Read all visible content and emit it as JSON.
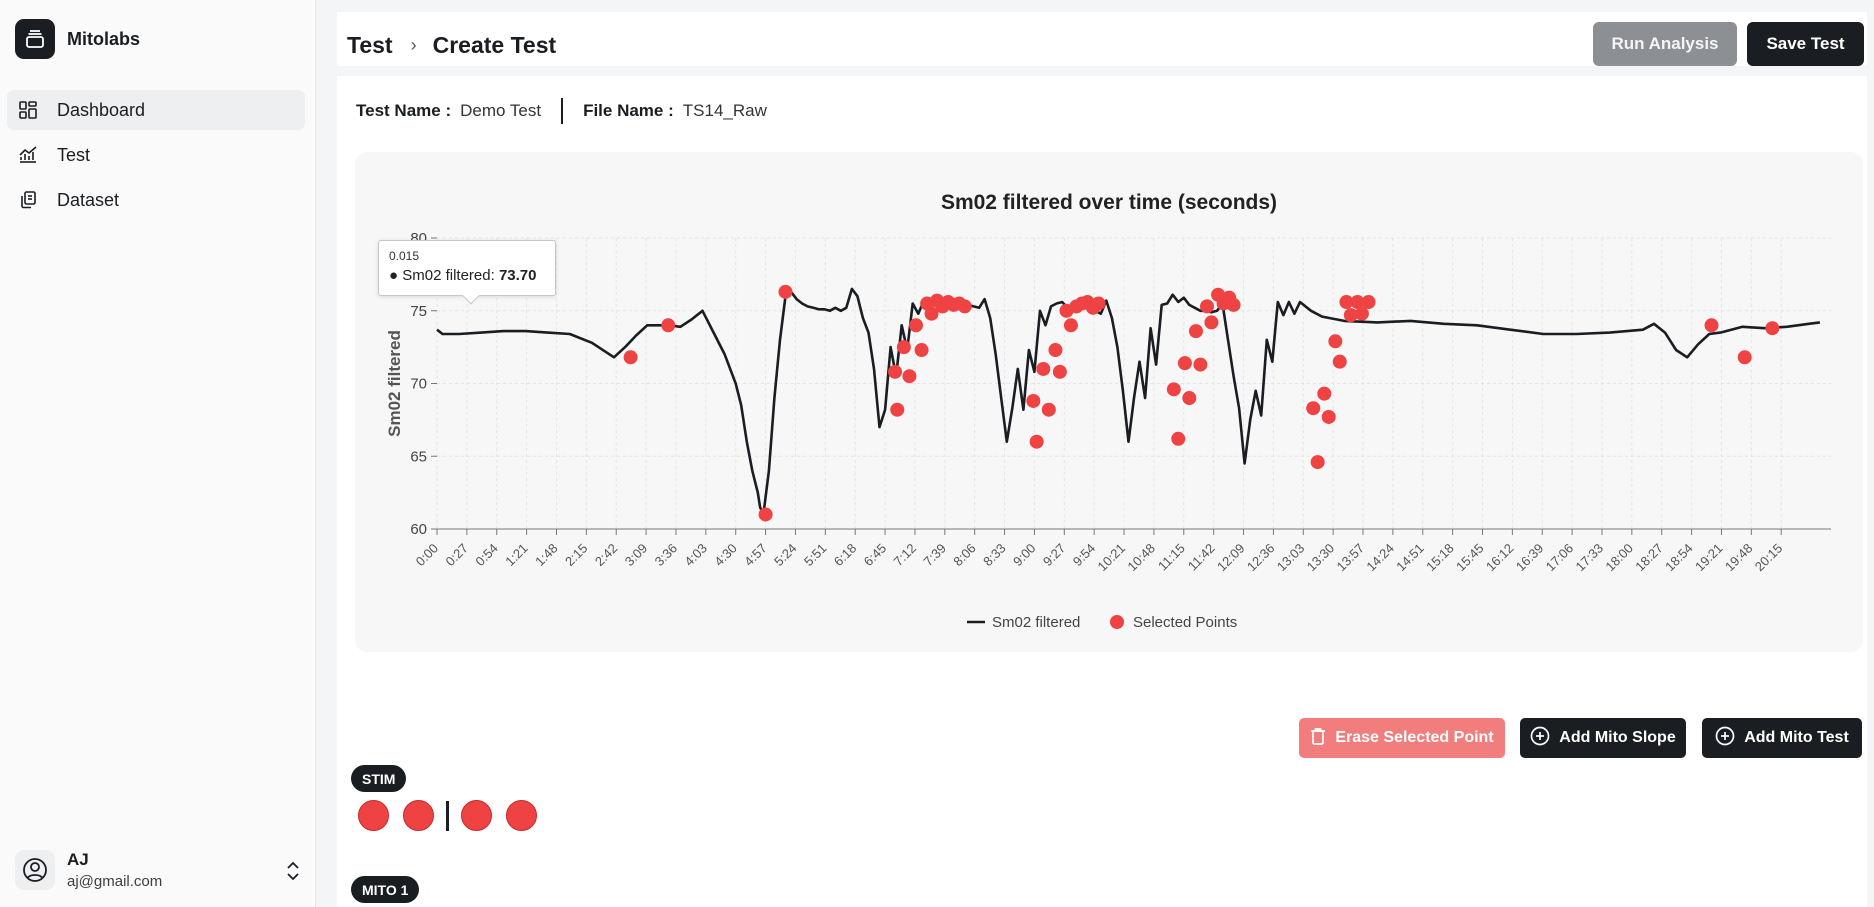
{
  "app": {
    "name": "Mitolabs"
  },
  "sidebar": {
    "items": [
      {
        "label": "Dashboard",
        "icon": "dashboard-icon",
        "active": true
      },
      {
        "label": "Test",
        "icon": "chart-line-icon",
        "active": false
      },
      {
        "label": "Dataset",
        "icon": "dataset-icon",
        "active": false
      }
    ],
    "user": {
      "name": "AJ",
      "email": "aj@gmail.com"
    }
  },
  "header": {
    "breadcrumb": [
      "Test",
      "Create Test"
    ],
    "run_label": "Run Analysis",
    "save_label": "Save Test"
  },
  "meta": {
    "test_name_key": "Test Name :",
    "test_name_value": "Demo Test",
    "file_name_key": "File Name :",
    "file_name_value": "TS14_Raw"
  },
  "tooltip": {
    "x": "0.015",
    "series": "Sm02 filtered",
    "value": "73.70"
  },
  "actions": {
    "erase_label": "Erase Selected Point",
    "add_slope_label": "Add Mito Slope",
    "add_test_label": "Add Mito Test"
  },
  "sections": {
    "stim_label": "STIM",
    "mito_label": "MITO 1"
  },
  "colors": {
    "line": "#1a1d21",
    "points": "#ef4343",
    "accent": "#1a1d21",
    "erase": "#f27d7d"
  },
  "chart_data": {
    "type": "line",
    "title": "Sm02 filtered over time (seconds)",
    "xlabel": "",
    "ylabel": "Sm02 filtered",
    "ylim": [
      60,
      80
    ],
    "xlim": [
      0,
      1260
    ],
    "yticks": [
      60,
      65,
      70,
      75,
      80
    ],
    "xticks": [
      "0:00",
      "0:27",
      "0:54",
      "1:21",
      "1:48",
      "2:15",
      "2:42",
      "3:09",
      "3:36",
      "4:03",
      "4:30",
      "4:57",
      "5:24",
      "5:51",
      "6:18",
      "6:45",
      "7:12",
      "7:39",
      "8:06",
      "8:33",
      "9:00",
      "9:27",
      "9:54",
      "10:21",
      "10:48",
      "11:15",
      "11:42",
      "12:09",
      "12:36",
      "13:03",
      "13:30",
      "13:57",
      "14:24",
      "14:51",
      "15:18",
      "15:45",
      "16:12",
      "16:39",
      "17:06",
      "17:33",
      "18:00",
      "18:27",
      "18:54",
      "19:21",
      "19:48",
      "20:15"
    ],
    "grid": true,
    "legend": {
      "position": "bottom",
      "entries": [
        "Sm02 filtered",
        "Selected Points"
      ]
    },
    "series": [
      {
        "name": "Sm02 filtered",
        "x": [
          0,
          5,
          20,
          40,
          60,
          80,
          100,
          120,
          140,
          160,
          170,
          180,
          190,
          200,
          210,
          220,
          230,
          240,
          250,
          260,
          270,
          275,
          280,
          285,
          290,
          292,
          295,
          300,
          305,
          310,
          315,
          320,
          325,
          330,
          335,
          340,
          345,
          350,
          355,
          360,
          365,
          370,
          375,
          380,
          385,
          390,
          395,
          400,
          405,
          410,
          415,
          420,
          425,
          430,
          435,
          440,
          445,
          450,
          455,
          460,
          465,
          470,
          475,
          480,
          485,
          490,
          495,
          500,
          505,
          510,
          515,
          520,
          525,
          530,
          535,
          540,
          545,
          550,
          555,
          560,
          565,
          570,
          575,
          580,
          585,
          590,
          595,
          600,
          605,
          610,
          615,
          620,
          625,
          630,
          635,
          640,
          645,
          650,
          655,
          660,
          665,
          670,
          675,
          680,
          685,
          690,
          695,
          700,
          705,
          710,
          715,
          720,
          725,
          730,
          735,
          740,
          745,
          750,
          755,
          760,
          765,
          770,
          775,
          780,
          790,
          800,
          820,
          850,
          880,
          910,
          940,
          970,
          1000,
          1030,
          1060,
          1090,
          1100,
          1110,
          1120,
          1130,
          1140,
          1150,
          1160,
          1180,
          1200,
          1220,
          1240,
          1250
        ],
        "values": [
          73.7,
          73.4,
          73.4,
          73.5,
          73.6,
          73.6,
          73.5,
          73.4,
          72.8,
          71.8,
          72.5,
          73.3,
          74.0,
          74.0,
          74.0,
          73.9,
          74.4,
          75.0,
          73.5,
          72.0,
          70.0,
          68.5,
          66.0,
          64.0,
          62.5,
          61.5,
          61.0,
          64.0,
          69.0,
          73.0,
          76.0,
          76.3,
          75.8,
          75.5,
          75.3,
          75.2,
          75.1,
          75.1,
          75.0,
          75.2,
          75.0,
          75.2,
          76.5,
          76.0,
          74.5,
          73.5,
          71.0,
          67.0,
          68.2,
          72.5,
          70.5,
          74.0,
          72.3,
          75.5,
          74.8,
          75.7,
          75.3,
          75.6,
          75.4,
          75.3,
          75.4,
          75.5,
          75.3,
          75.4,
          75.3,
          75.2,
          75.8,
          74.5,
          72.0,
          69.0,
          66.0,
          68.3,
          71.0,
          68.2,
          72.3,
          70.8,
          75.0,
          74.0,
          75.3,
          75.5,
          75.6,
          75.2,
          75.5,
          75.3,
          75.2,
          75.2,
          75.0,
          74.8,
          75.7,
          74.5,
          72.5,
          69.5,
          66.0,
          69.0,
          71.5,
          69.0,
          73.8,
          71.3,
          75.4,
          75.5,
          76.1,
          75.6,
          75.9,
          75.4,
          75.2,
          75.0,
          75.0,
          74.9,
          75.0,
          75.5,
          73.0,
          70.5,
          68.3,
          64.5,
          67.5,
          69.5,
          67.8,
          73.0,
          71.5,
          75.6,
          74.7,
          75.6,
          74.8,
          75.6,
          75.0,
          74.6,
          74.3,
          74.2,
          74.3,
          74.1,
          74.0,
          73.7,
          73.4,
          73.4,
          73.5,
          73.7,
          74.1,
          73.5,
          72.3,
          71.8,
          72.7,
          73.4,
          73.5,
          73.9,
          73.8,
          73.9,
          74.1,
          74.2
        ]
      }
    ],
    "selected_points": [
      [
        175,
        71.8
      ],
      [
        209,
        74.0
      ],
      [
        297,
        61.0
      ],
      [
        315,
        76.3
      ],
      [
        414,
        70.8
      ],
      [
        416,
        68.2
      ],
      [
        422,
        72.5
      ],
      [
        427,
        70.5
      ],
      [
        433,
        74.0
      ],
      [
        438,
        72.3
      ],
      [
        443,
        75.5
      ],
      [
        447,
        74.8
      ],
      [
        452,
        75.7
      ],
      [
        457,
        75.3
      ],
      [
        462,
        75.6
      ],
      [
        467,
        75.4
      ],
      [
        472,
        75.5
      ],
      [
        477,
        75.3
      ],
      [
        539,
        68.8
      ],
      [
        542,
        66.0
      ],
      [
        548,
        71.0
      ],
      [
        553,
        68.2
      ],
      [
        559,
        72.3
      ],
      [
        563,
        70.8
      ],
      [
        569,
        75.0
      ],
      [
        573,
        74.0
      ],
      [
        578,
        75.3
      ],
      [
        583,
        75.5
      ],
      [
        588,
        75.6
      ],
      [
        593,
        75.2
      ],
      [
        598,
        75.5
      ],
      [
        666,
        69.6
      ],
      [
        670,
        66.2
      ],
      [
        676,
        71.4
      ],
      [
        680,
        69.0
      ],
      [
        686,
        73.6
      ],
      [
        690,
        71.3
      ],
      [
        696,
        75.3
      ],
      [
        700,
        74.2
      ],
      [
        706,
        76.1
      ],
      [
        711,
        75.5
      ],
      [
        716,
        75.9
      ],
      [
        720,
        75.4
      ],
      [
        792,
        68.3
      ],
      [
        796,
        64.6
      ],
      [
        802,
        69.3
      ],
      [
        806,
        67.7
      ],
      [
        812,
        72.9
      ],
      [
        816,
        71.5
      ],
      [
        822,
        75.6
      ],
      [
        826,
        74.7
      ],
      [
        832,
        75.6
      ],
      [
        836,
        74.8
      ],
      [
        842,
        75.6
      ],
      [
        1152,
        74.0
      ],
      [
        1182,
        71.8
      ],
      [
        1207,
        73.8
      ]
    ]
  }
}
